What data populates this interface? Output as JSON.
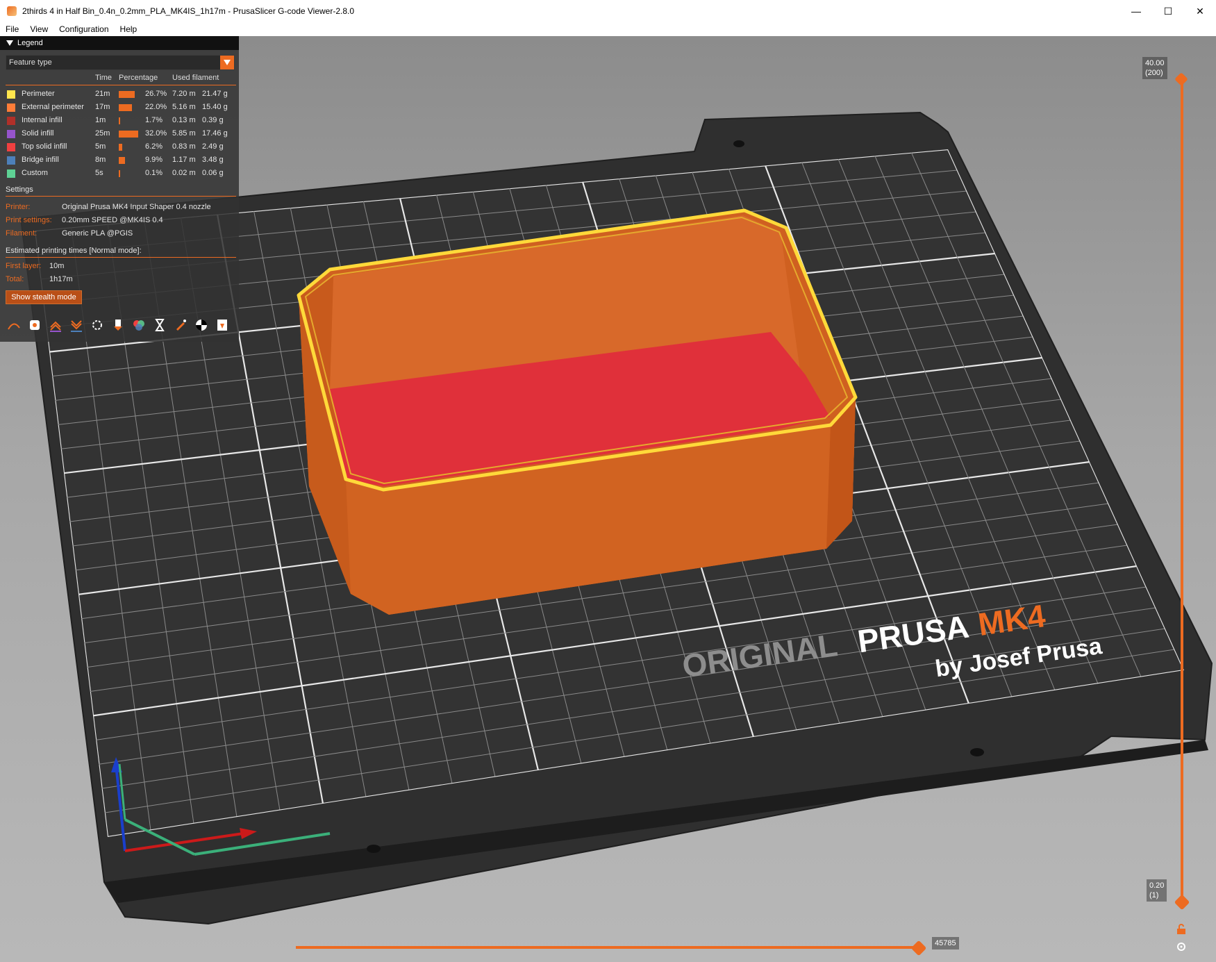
{
  "window": {
    "title": "2thirds 4 in Half Bin_0.4n_0.2mm_PLA_MK4IS_1h17m - PrusaSlicer G-code Viewer-2.8.0",
    "controls": [
      "minimize-icon",
      "maximize-icon",
      "close-icon"
    ]
  },
  "menu": [
    "File",
    "View",
    "Configuration",
    "Help"
  ],
  "legend": {
    "header": "Legend",
    "view_type": "Feature type",
    "columns": {
      "time": "Time",
      "percentage": "Percentage",
      "filament": "Used filament"
    },
    "features": [
      {
        "name": "Perimeter",
        "time": "21m",
        "pct": "26.7%",
        "pct_value": 26.7,
        "len": "7.20 m",
        "weight": "21.47 g",
        "color": "#ffe64d"
      },
      {
        "name": "External perimeter",
        "time": "17m",
        "pct": "22.0%",
        "pct_value": 22.0,
        "len": "5.16 m",
        "weight": "15.40 g",
        "color": "#ff7d38"
      },
      {
        "name": "Internal infill",
        "time": "1m",
        "pct": "1.7%",
        "pct_value": 1.7,
        "len": "0.13 m",
        "weight": "0.39 g",
        "color": "#b03029"
      },
      {
        "name": "Solid infill",
        "time": "25m",
        "pct": "32.0%",
        "pct_value": 32.0,
        "len": "5.85 m",
        "weight": "17.46 g",
        "color": "#9654cc"
      },
      {
        "name": "Top solid infill",
        "time": "5m",
        "pct": "6.2%",
        "pct_value": 6.2,
        "len": "0.83 m",
        "weight": "2.49 g",
        "color": "#f04040"
      },
      {
        "name": "Bridge infill",
        "time": "8m",
        "pct": "9.9%",
        "pct_value": 9.9,
        "len": "1.17 m",
        "weight": "3.48 g",
        "color": "#4d80ba"
      },
      {
        "name": "Custom",
        "time": "5s",
        "pct": "0.1%",
        "pct_value": 0.1,
        "len": "0.02 m",
        "weight": "0.06 g",
        "color": "#5ed194"
      }
    ],
    "settings_title": "Settings",
    "printer_label": "Printer:",
    "printer_value": "Original Prusa MK4 Input Shaper 0.4 nozzle",
    "print_label": "Print settings:",
    "print_value": "0.20mm SPEED @MK4IS 0.4",
    "filament_label": "Filament:",
    "filament_value": "Generic PLA @PGIS",
    "times_title": "Estimated printing times [Normal mode]:",
    "first_layer_label": "First layer:",
    "first_layer_value": "10m",
    "total_label": "Total:",
    "total_value": "1h17m",
    "stealth_button": "Show stealth mode",
    "tool_icons": [
      "travel-icon",
      "wipe-icon",
      "retractions-icon",
      "deretractions-icon",
      "seams-icon",
      "tool-changes-icon",
      "color-changes-icon",
      "pause-prints-icon",
      "custom-gcodes-icon",
      "center-of-gravity-icon",
      "shells-icon",
      "tool-marker-icon"
    ]
  },
  "vertical_slider": {
    "top_value": "40.00",
    "top_layer": "(200)",
    "bottom_value": "0.20",
    "bottom_layer": "(1)"
  },
  "horizontal_slider": {
    "value": "45785"
  },
  "bed": {
    "brand_original": "ORIGINAL",
    "brand_prusa": "PRUSA",
    "brand_model": "MK4",
    "brand_by": "by Josef Prusa"
  },
  "colors": {
    "accent": "#ed6b21",
    "object": "#d9651f",
    "top_surface": "#e0303a",
    "outline": "#ffd93a"
  }
}
